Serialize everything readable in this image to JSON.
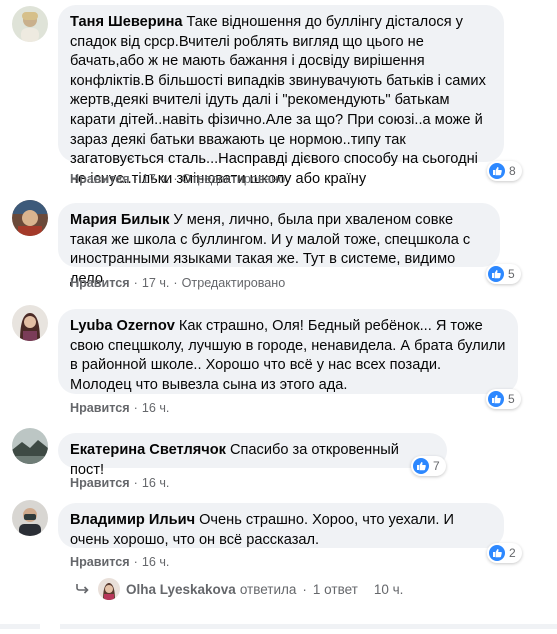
{
  "comments": [
    {
      "author": "Таня Шеверина",
      "text": "Таке відношення до буллінгу дісталося у спадок від срср.Вчителі роблять вигляд що цього не бачать,або ж не мають бажання і досвіду вирішення конфліктів.В більшості випадків звинувачують батьків і самих жертв,деякі вчителі ідуть далі і \"рекомендують\" батькам карати дітей..навіть фізично.Але за що? При союзі..а може й зараз деякі батьки вважають це нормою..типу так загатовується сталь...Насправді дієвого способу на сьогодні не існує..тільки змінювати школу або країну",
      "like_label": "Нравится",
      "time": "17 ч.",
      "edited": "Отредактировано",
      "reactions": "8"
    },
    {
      "author": "Мария Билык",
      "text": "У меня, лично, была при хваленом совке такая же школа с буллингом. И у малой тоже, спецшкола с иностранными языками такая же. Тут в системе, видимо дело",
      "like_label": "Нравится",
      "time": "17 ч.",
      "edited": "Отредактировано",
      "reactions": "5"
    },
    {
      "author": "Lyuba Ozernov",
      "text": "Как страшно, Оля! Бедный ребёнок... Я тоже свою спецшколу, лучшую в городе, ненавидела. А брата булили в районной школе.. Хорошо что всё у нас всех позади. Молодец что вывезла сына из этого ада.",
      "like_label": "Нравится",
      "time": "16 ч.",
      "reactions": "5"
    },
    {
      "author": "Екатерина Светлячок",
      "text": "Спасибо за откровенный пост!",
      "like_label": "Нравится",
      "time": "16 ч.",
      "reactions": "7"
    },
    {
      "author": "Владимир Ильич",
      "text": "Очень страшно. Хороо, что уехали. И очень хорошо, что он всё рассказал.",
      "like_label": "Нравится",
      "time": "16 ч.",
      "reactions": "2"
    }
  ],
  "reply_summary": {
    "name": "Olha Lyeskakova",
    "action": "ответила",
    "count": "1 ответ",
    "time": "10 ч."
  },
  "colors": {
    "bubble": "#f0f2f5",
    "meta_text": "#65676b",
    "like_blue": "#2d88ff"
  },
  "icons": {
    "reply_arrow": "reply-arrow-icon",
    "like": "like-icon"
  }
}
